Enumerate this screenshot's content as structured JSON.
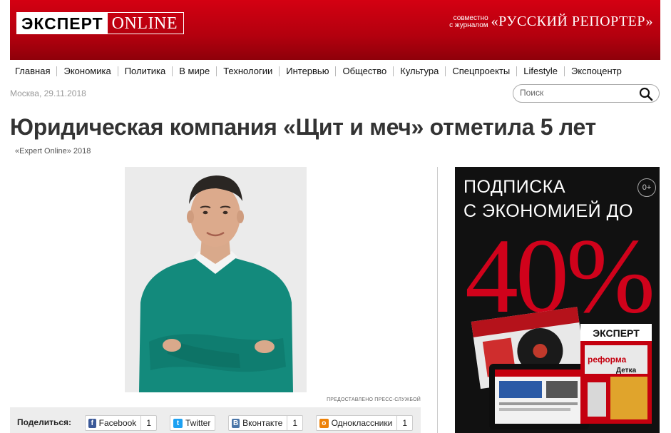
{
  "header": {
    "logo_left": "ЭКСПЕРТ",
    "logo_right": "ONLINE",
    "partner_small_1": "совместно",
    "partner_small_2": "с журналом",
    "partner_big": "«РУССКИЙ РЕПОРТЕР»",
    "brand_color": "#c4000f"
  },
  "nav": {
    "items": [
      "Главная",
      "Экономика",
      "Политика",
      "В мире",
      "Технологии",
      "Интервью",
      "Общество",
      "Культура",
      "Спецпроекты",
      "Lifestyle",
      "Экспоцентр"
    ]
  },
  "meta": {
    "dateline": "Москва, 29.11.2018",
    "source": "«Expert Online» 2018"
  },
  "search": {
    "placeholder": "Поиск"
  },
  "article": {
    "title": "Юридическая компания «Щит и меч» отметила 5 лет",
    "photo_credit": "ПРЕДОСТАВЛЕНО ПРЕСС-СЛУЖБОЙ"
  },
  "share": {
    "label": "Поделиться:",
    "buttons": [
      {
        "name": "Facebook",
        "count": "1",
        "icon": "facebook-icon",
        "color": "#3b5998"
      },
      {
        "name": "Twitter",
        "count": "",
        "icon": "twitter-icon",
        "color": "#1da1f2"
      },
      {
        "name": "Вконтакте",
        "count": "1",
        "icon": "vk-icon",
        "color": "#4a76a8"
      },
      {
        "name": "Одноклассники",
        "count": "1",
        "icon": "ok-icon",
        "color": "#ee8208"
      }
    ]
  },
  "ad": {
    "line1": "ПОДПИСКА",
    "line2": "С ЭКОНОМИЕЙ ДО",
    "percent": "40%",
    "age": "0+",
    "magazine_logo": "ЭКСПЕРТ",
    "cover_word_1": "реформа",
    "cover_word_2": "Детка"
  }
}
